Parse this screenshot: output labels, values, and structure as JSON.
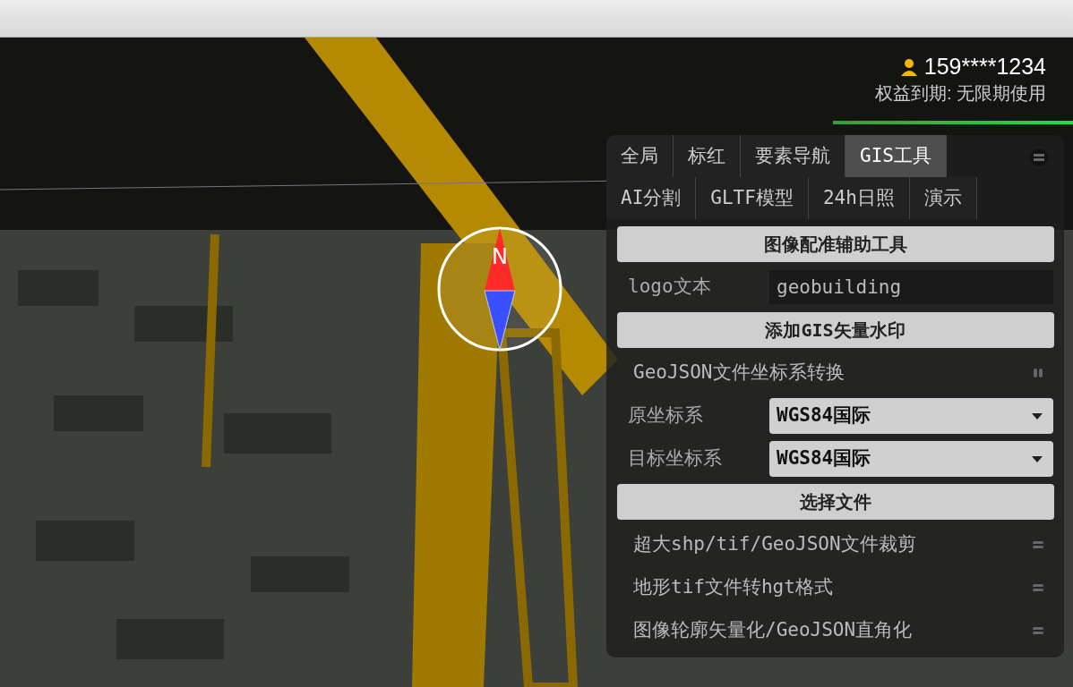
{
  "user": {
    "phone": "159****1234",
    "expiry": "权益到期: 无限期使用"
  },
  "compass": {
    "label": "N"
  },
  "tabs": [
    {
      "label": "全局",
      "selected": false
    },
    {
      "label": "标红",
      "selected": false
    },
    {
      "label": "要素导航",
      "selected": false
    },
    {
      "label": "GIS工具",
      "selected": true
    },
    {
      "label": "AI分割",
      "selected": false
    },
    {
      "label": "GLTF模型",
      "selected": false
    },
    {
      "label": "24h日照",
      "selected": false
    },
    {
      "label": "演示",
      "selected": false
    }
  ],
  "tools": [
    {
      "kind": "button",
      "label": "图像配准辅助工具"
    },
    {
      "kind": "field",
      "label": "logo文本",
      "value": "geobuilding"
    },
    {
      "kind": "button",
      "label": "添加GIS矢量水印"
    },
    {
      "kind": "section",
      "title": "GeoJSON文件坐标系转换",
      "expanded": true
    },
    {
      "kind": "select",
      "label": "原坐标系",
      "value": "WGS84国际"
    },
    {
      "kind": "select",
      "label": "目标坐标系",
      "value": "WGS84国际"
    },
    {
      "kind": "button",
      "label": "选择文件"
    },
    {
      "kind": "section",
      "title": "超大shp/tif/GeoJSON文件裁剪",
      "expanded": false
    },
    {
      "kind": "section",
      "title": "地形tif文件转hgt格式",
      "expanded": false
    },
    {
      "kind": "section",
      "title": "图像轮廓矢量化/GeoJSON直角化",
      "expanded": false
    }
  ]
}
